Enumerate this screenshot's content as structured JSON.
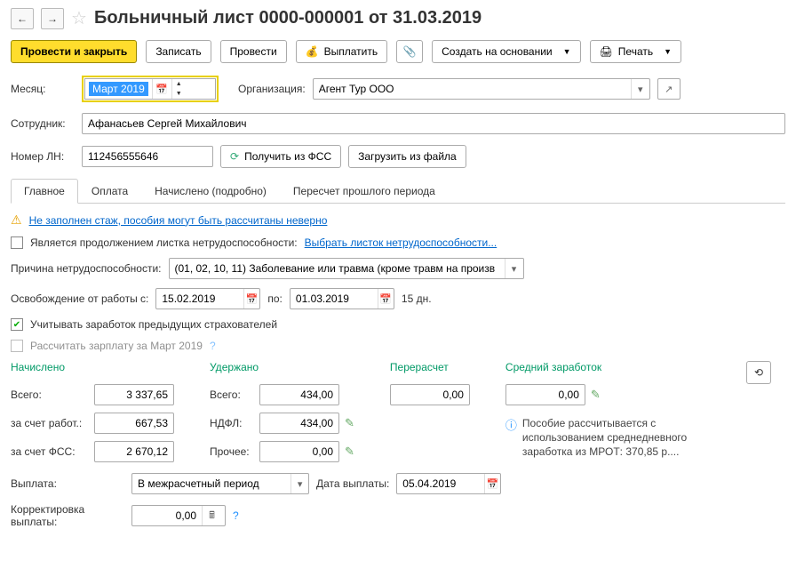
{
  "title": "Больничный лист 0000-000001 от 31.03.2019",
  "toolbar": {
    "submit_close": "Провести и закрыть",
    "save": "Записать",
    "post": "Провести",
    "pay": "Выплатить",
    "create_based": "Создать на основании",
    "print": "Печать"
  },
  "form": {
    "month_label": "Месяц:",
    "month_value": "Март 2019",
    "org_label": "Организация:",
    "org_value": "Агент Тур ООО",
    "employee_label": "Сотрудник:",
    "employee_value": "Афанасьев Сергей Михайлович",
    "ln_label": "Номер ЛН:",
    "ln_value": "112456555646",
    "get_fss": "Получить из ФСС",
    "load_file": "Загрузить из файла"
  },
  "tabs": {
    "main": "Главное",
    "payment": "Оплата",
    "accrued": "Начислено (подробно)",
    "recalc": "Пересчет прошлого периода"
  },
  "main_tab": {
    "warning": "Не заполнен стаж, пособия могут быть рассчитаны неверно",
    "continuation_label": "Является продолжением листка нетрудоспособности:",
    "continuation_link": "Выбрать листок нетрудоспособности...",
    "reason_label": "Причина нетрудоспособности:",
    "reason_value": "(01, 02, 10, 11) Заболевание или травма (кроме травм на произв",
    "release_label": "Освобождение от работы с:",
    "date_from": "15.02.2019",
    "to_label": "по:",
    "date_to": "01.03.2019",
    "days": "15 дн.",
    "prev_insurers": "Учитывать заработок предыдущих страхователей",
    "calc_salary": "Рассчитать зарплату за Март 2019"
  },
  "calc": {
    "accrued": "Начислено",
    "withheld": "Удержано",
    "recalc": "Перерасчет",
    "avg_earnings": "Средний заработок",
    "total": "Всего:",
    "employer": "за счет работ.:",
    "fss": "за счет ФСС:",
    "ndfl": "НДФЛ:",
    "other": "Прочее:",
    "v_total": "3 337,65",
    "v_employer": "667,53",
    "v_fss": "2 670,12",
    "v_withheld_total": "434,00",
    "v_ndfl": "434,00",
    "v_other": "0,00",
    "v_recalc": "0,00",
    "v_avg": "0,00",
    "info": "Пособие рассчитывается с использованием среднедневного заработка из МРОТ: 370,85 р...."
  },
  "payout": {
    "label": "Выплата:",
    "value": "В межрасчетный период",
    "date_label": "Дата выплаты:",
    "date_value": "05.04.2019",
    "correction_label": "Корректировка выплаты:",
    "correction_value": "0,00"
  }
}
